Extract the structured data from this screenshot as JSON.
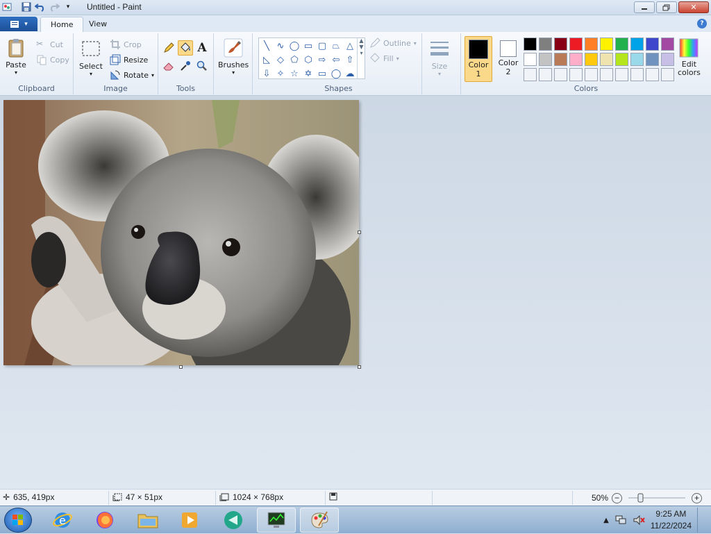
{
  "window": {
    "title": "Untitled - Paint"
  },
  "tabs": [
    {
      "label": "Home",
      "active": true
    },
    {
      "label": "View",
      "active": false
    }
  ],
  "clipboard": {
    "paste": "Paste",
    "cut": "Cut",
    "copy": "Copy",
    "group": "Clipboard"
  },
  "image": {
    "select": "Select",
    "crop": "Crop",
    "resize": "Resize",
    "rotate": "Rotate",
    "group": "Image"
  },
  "tools": {
    "group": "Tools"
  },
  "brushes": {
    "label": "Brushes"
  },
  "shapes": {
    "group": "Shapes",
    "outline": "Outline",
    "fill": "Fill"
  },
  "size": {
    "label": "Size"
  },
  "colors": {
    "group": "Colors",
    "color1_label": "Color",
    "color1_num": "1",
    "color2_label": "Color",
    "color2_num": "2",
    "edit_label": "Edit",
    "edit_label2": "colors",
    "color1": "#000000",
    "color2": "#ffffff",
    "palette": [
      "#000000",
      "#7f7f7f",
      "#880015",
      "#ed1c24",
      "#ff7f27",
      "#fff200",
      "#22b14c",
      "#00a2e8",
      "#3f48cc",
      "#a349a4",
      "#ffffff",
      "#c3c3c3",
      "#b97a57",
      "#ffaec9",
      "#ffc90e",
      "#efe4b0",
      "#b5e61d",
      "#99d9ea",
      "#7092be",
      "#c8bfe7",
      "#f0f3f7",
      "#f0f3f7",
      "#f0f3f7",
      "#f0f3f7",
      "#f0f3f7",
      "#f0f3f7",
      "#f0f3f7",
      "#f0f3f7",
      "#f0f3f7",
      "#f0f3f7"
    ]
  },
  "status": {
    "cursor_pos": "635, 419px",
    "selection_size": "47 × 51px",
    "image_size": "1024 × 768px",
    "zoom": "50%"
  },
  "taskbar": {
    "time": "9:25 AM",
    "date": "11/22/2024"
  }
}
